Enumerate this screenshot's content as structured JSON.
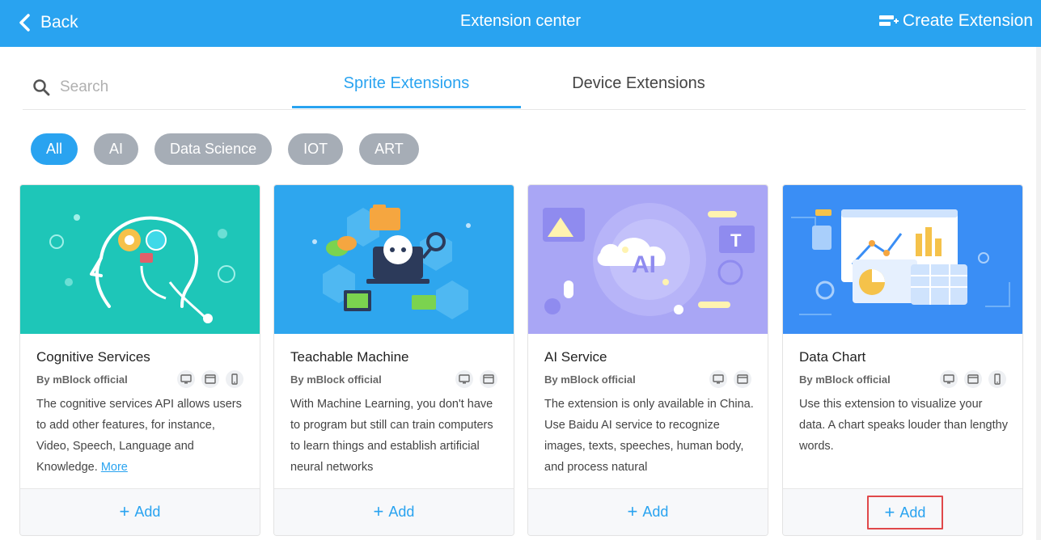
{
  "header": {
    "back_label": "Back",
    "title": "Extension center",
    "create_label": "Create Extension"
  },
  "search": {
    "placeholder": "Search"
  },
  "tabs": [
    {
      "label": "Sprite Extensions",
      "active": true
    },
    {
      "label": "Device Extensions",
      "active": false
    }
  ],
  "filters": [
    {
      "label": "All",
      "active": true
    },
    {
      "label": "AI",
      "active": false
    },
    {
      "label": "Data Science",
      "active": false
    },
    {
      "label": "IOT",
      "active": false
    },
    {
      "label": "ART",
      "active": false
    }
  ],
  "cards": [
    {
      "title": "Cognitive Services",
      "author": "By mBlock official",
      "desc": "The cognitive services API allows users to add other features, for instance, Video, Speech, Language and Knowledge.",
      "more": "More",
      "platforms": [
        "desktop-icon",
        "browser-icon",
        "mobile-icon"
      ],
      "add": "Add"
    },
    {
      "title": "Teachable Machine",
      "author": "By mBlock official",
      "desc": "With Machine Learning, you don't have to program but still can train computers to learn things and establish artificial neural networks",
      "platforms": [
        "desktop-icon",
        "browser-icon"
      ],
      "add": "Add"
    },
    {
      "title": "AI Service",
      "author": "By mBlock official",
      "desc": "The extension is only available in China. Use Baidu AI service to recognize images, texts, speeches, human body, and process natural",
      "platforms": [
        "desktop-icon",
        "browser-icon"
      ],
      "add": "Add"
    },
    {
      "title": "Data Chart",
      "author": "By mBlock official",
      "desc": "Use this extension to visualize your data. A chart speaks louder than lengthy words.",
      "platforms": [
        "desktop-icon",
        "browser-icon",
        "mobile-icon"
      ],
      "add": "Add"
    }
  ],
  "colors": {
    "accent": "#29a3f0",
    "chip_inactive": "#a6adb6",
    "highlight_border": "#e0484a"
  }
}
